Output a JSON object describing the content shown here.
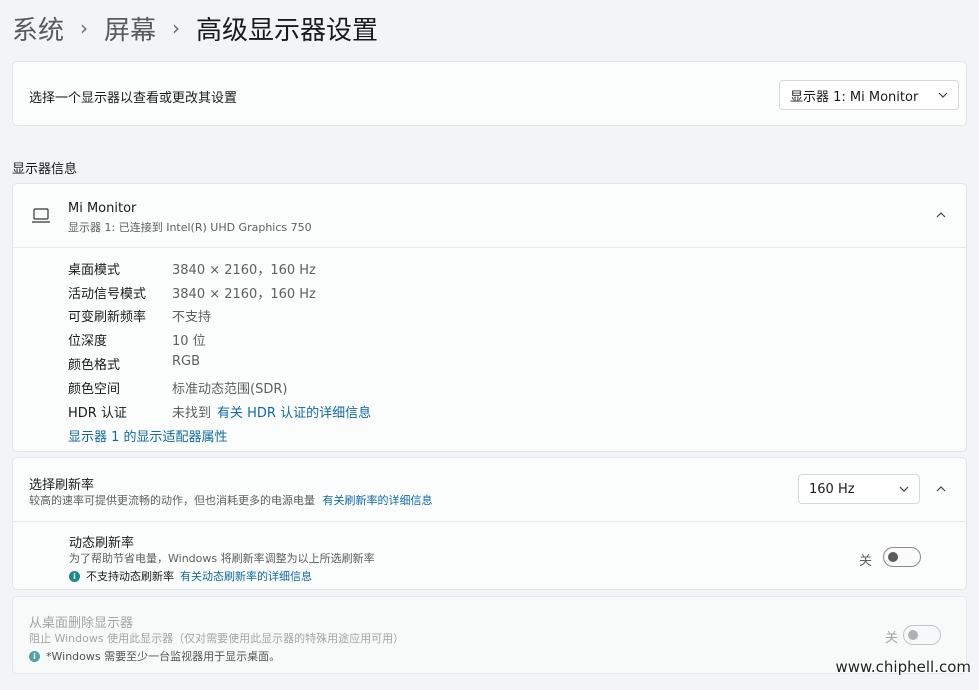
{
  "breadcrumb": [
    "系统",
    "屏幕",
    "高级显示器设置"
  ],
  "selector": {
    "label": "选择一个显示器以查看或更改其设置",
    "value": "显示器 1: Mi Monitor"
  },
  "display_info": {
    "section_title": "显示器信息",
    "monitor_name": "Mi Monitor",
    "monitor_sub": "显示器 1: 已连接到 Intel(R) UHD Graphics 750",
    "rows": [
      {
        "key": "桌面模式",
        "value": "3840 × 2160，160 Hz"
      },
      {
        "key": "活动信号模式",
        "value": "3840 × 2160，160 Hz"
      },
      {
        "key": "可变刷新频率",
        "value": "不支持"
      },
      {
        "key": "位深度",
        "value": "10 位"
      },
      {
        "key": "颜色格式",
        "value": "RGB"
      },
      {
        "key": "颜色空间",
        "value": "标准动态范围(SDR)"
      },
      {
        "key": "HDR 认证",
        "value": "未找到"
      }
    ],
    "hdr_link": "有关 HDR 认证的详细信息",
    "adapter_link": "显示器 1 的显示适配器属性"
  },
  "refresh": {
    "title": "选择刷新率",
    "desc": "较高的速率可提供更流畅的动作，但也消耗更多的电源电量",
    "link": "有关刷新率的详细信息",
    "value": "160 Hz"
  },
  "dynamic": {
    "title": "动态刷新率",
    "desc": "为了帮助节省电量，Windows 将刷新率调整为以上所选刷新率",
    "note": "不支持动态刷新率",
    "link": "有关动态刷新率的详细信息",
    "state": "关"
  },
  "remove": {
    "title": "从桌面删除显示器",
    "desc": "阻止 Windows 使用此显示器（仅对需要使用此显示器的特殊用途应用可用）",
    "note": "*Windows 需要至少一台监视器用于显示桌面。",
    "state": "关"
  },
  "watermark": "www.chiphell.com"
}
